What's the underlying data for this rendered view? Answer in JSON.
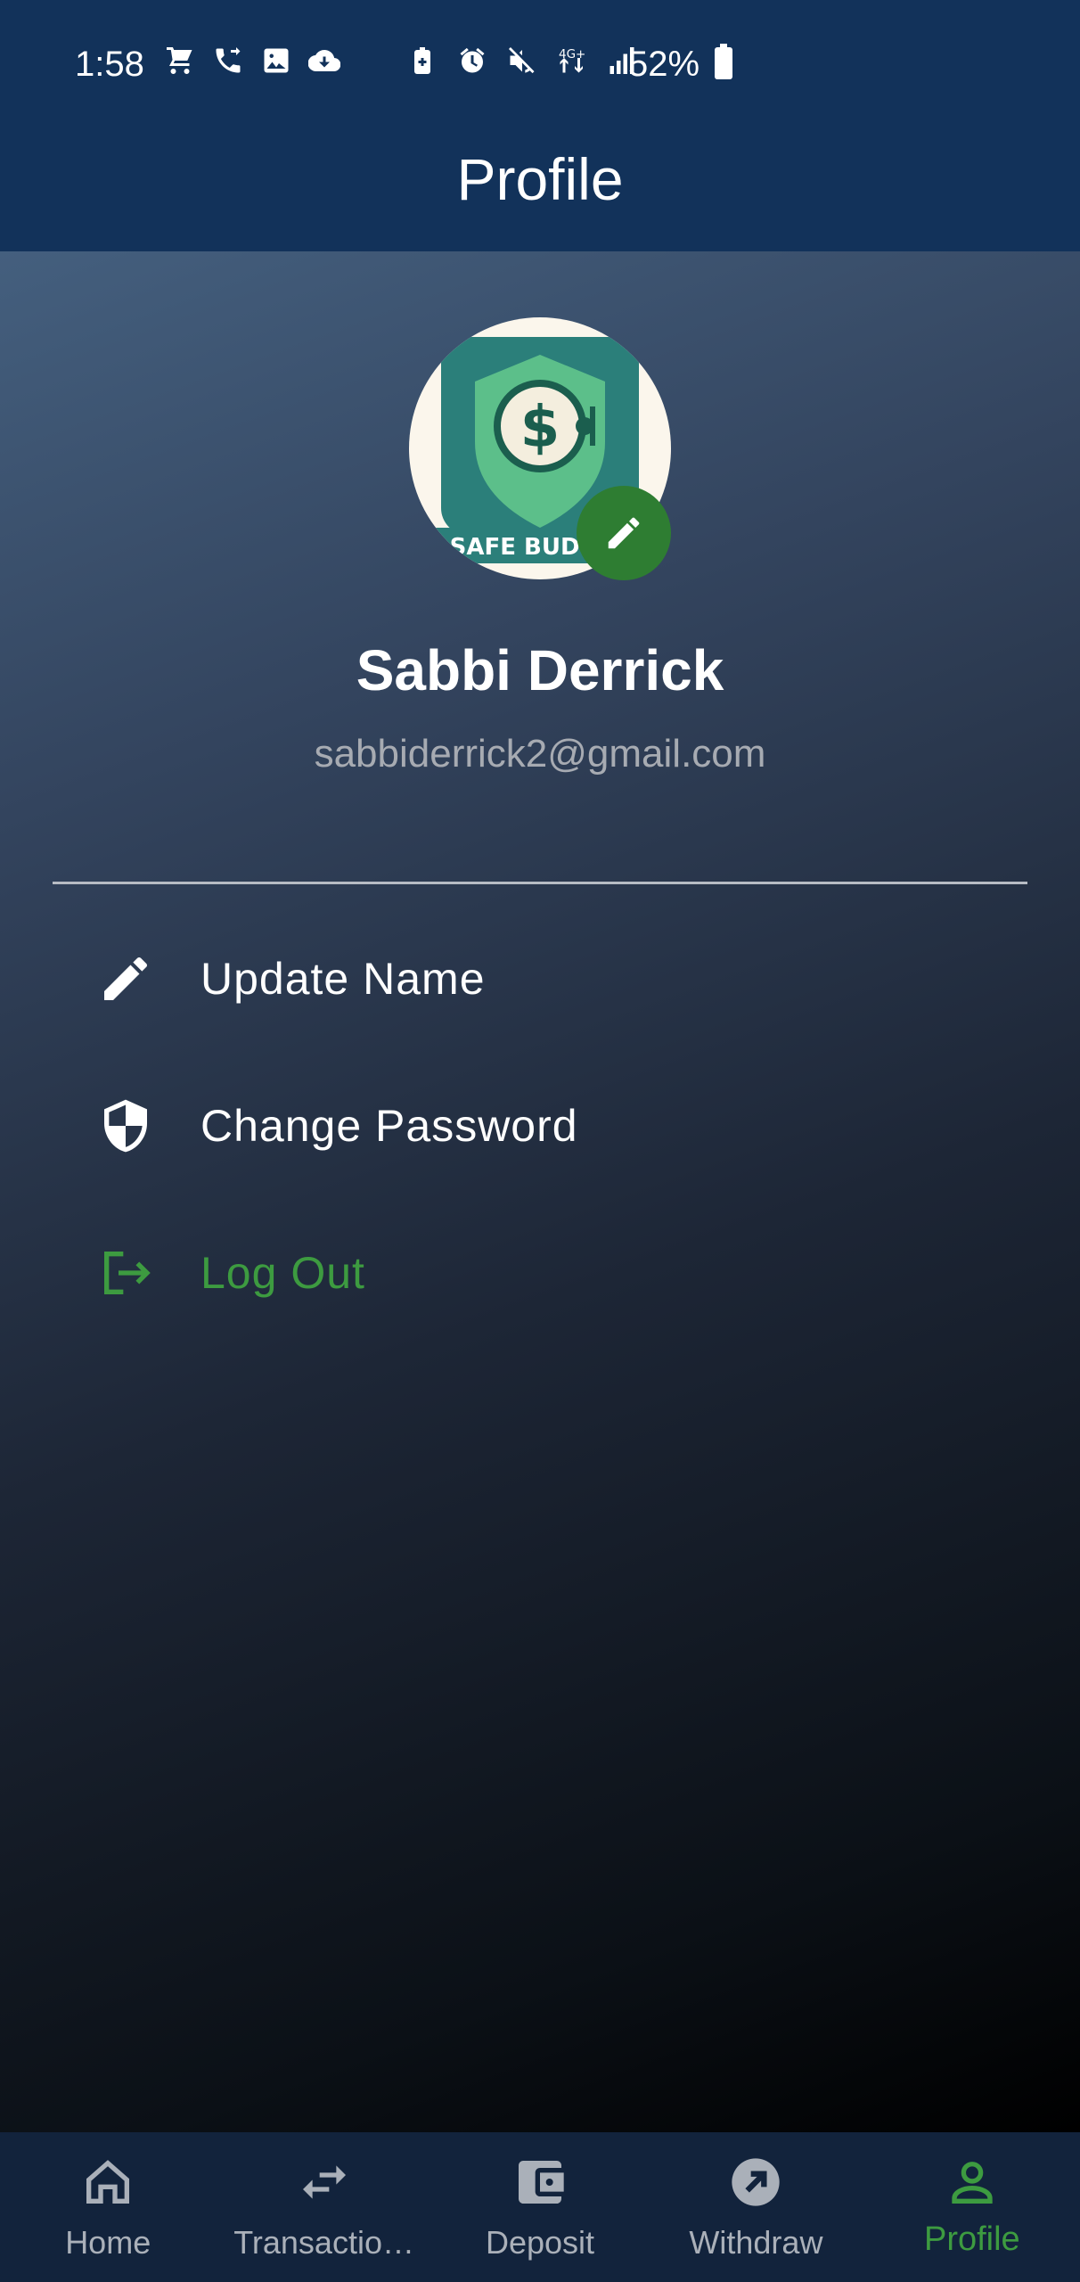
{
  "status_bar": {
    "time": "1:58",
    "battery": "52%",
    "left_icons": [
      "shopping-cart-icon",
      "call-forward-icon",
      "image-icon",
      "cloud-download-icon"
    ],
    "right_icons": [
      "battery-saver-icon",
      "alarm-icon",
      "mute-icon",
      "network-4g-icon",
      "signal-icon"
    ]
  },
  "header": {
    "title": "Profile"
  },
  "profile": {
    "name": "Sabbi Derrick",
    "email": "sabbiderrick2@gmail.com",
    "avatar_logo_text": "SAFE BUDGET"
  },
  "menu": {
    "items": [
      {
        "label": "Update Name",
        "icon": "pencil-icon"
      },
      {
        "label": "Change Password",
        "icon": "shield-icon"
      },
      {
        "label": "Log Out",
        "icon": "logout-icon"
      }
    ]
  },
  "bottom_nav": {
    "items": [
      {
        "label": "Home",
        "icon": "home-icon"
      },
      {
        "label": "Transactio…",
        "icon": "swap-arrows-icon"
      },
      {
        "label": "Deposit",
        "icon": "wallet-icon"
      },
      {
        "label": "Withdraw",
        "icon": "arrow-up-right-icon"
      },
      {
        "label": "Profile",
        "icon": "person-icon",
        "active": true
      }
    ]
  },
  "colors": {
    "primary_dark": "#12325a",
    "accent_green": "#2e7d32",
    "label_green": "#3d9b40",
    "nav_background": "#12233c"
  }
}
